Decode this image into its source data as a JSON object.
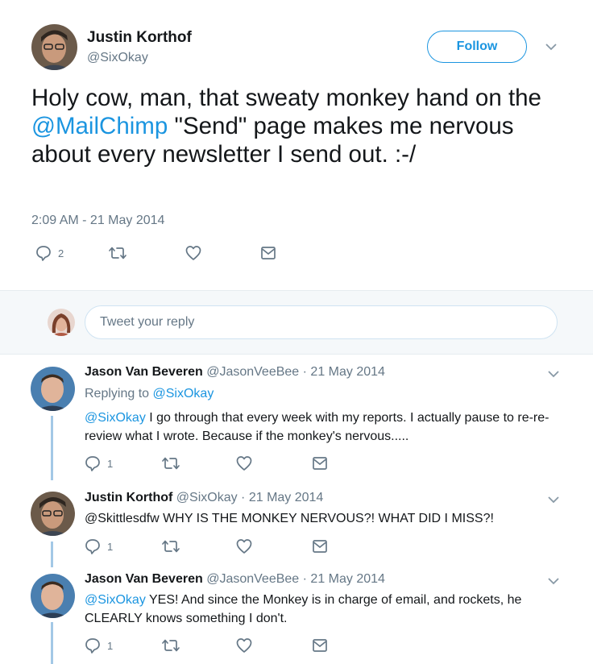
{
  "main_tweet": {
    "author_name": "Justin Korthof",
    "author_handle": "@SixOkay",
    "follow_label": "Follow",
    "text_before": "Holy cow, man, that sweaty monkey hand on the ",
    "mention": "@MailChimp",
    "text_after": " \"Send\" page makes me nervous about every newsletter I send out. :-/",
    "timestamp": "2:09 AM - 21 May 2014",
    "reply_count": "2"
  },
  "reply_box": {
    "placeholder": "Tweet your reply"
  },
  "replies": [
    {
      "author_name": "Jason Van Beveren",
      "author_handle": "@JasonVeeBee",
      "date": "· 21 May 2014",
      "replying_prefix": "Replying to ",
      "replying_to": "@SixOkay",
      "mention": "@SixOkay",
      "text": " I go through that every week with my reports.  I actually pause to re-re-review what I wrote.  Because if the monkey's nervous.....",
      "reply_count": "1"
    },
    {
      "author_name": "Justin Korthof",
      "author_handle": "@SixOkay",
      "date": "· 21 May 2014",
      "text": "@Skittlesdfw WHY IS THE MONKEY NERVOUS?! WHAT DID I MISS?!",
      "reply_count": "1"
    },
    {
      "author_name": "Jason Van Beveren",
      "author_handle": "@JasonVeeBee",
      "date": "· 21 May 2014",
      "mention": "@SixOkay",
      "text": " YES!  And since the Monkey is in charge of email, and rockets, he CLEARLY knows something I don't.",
      "reply_count": "1"
    }
  ],
  "colors": {
    "accent": "#1b95e0",
    "muted": "#657786",
    "thread_line": "#a3c8e6",
    "reply_bar_bg": "#f5f8fa"
  }
}
